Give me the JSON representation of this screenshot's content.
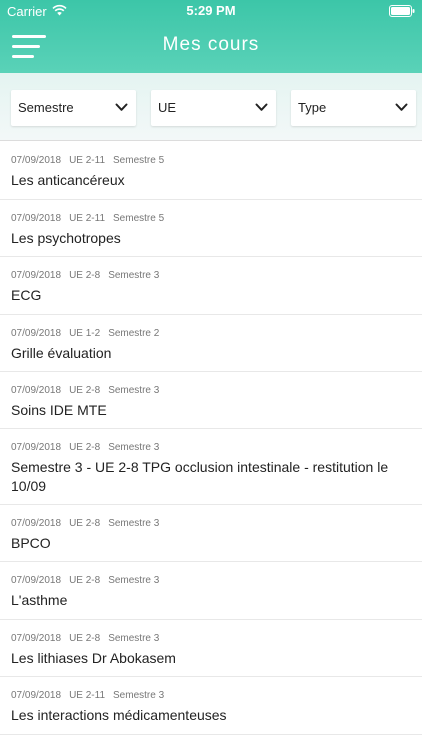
{
  "status": {
    "carrier": "Carrier",
    "time": "5:29 PM"
  },
  "header": {
    "title": "Mes cours"
  },
  "filters": [
    {
      "label": "Semestre"
    },
    {
      "label": "UE"
    },
    {
      "label": "Type"
    }
  ],
  "courses": [
    {
      "date": "07/09/2018",
      "ue": "UE 2-11",
      "semestre": "Semestre 5",
      "title": "Les anticancéreux"
    },
    {
      "date": "07/09/2018",
      "ue": "UE 2-11",
      "semestre": "Semestre 5",
      "title": "Les psychotropes"
    },
    {
      "date": "07/09/2018",
      "ue": "UE 2-8",
      "semestre": "Semestre 3",
      "title": "ECG"
    },
    {
      "date": "07/09/2018",
      "ue": "UE 1-2",
      "semestre": "Semestre 2",
      "title": "Grille évaluation"
    },
    {
      "date": "07/09/2018",
      "ue": "UE 2-8",
      "semestre": "Semestre 3",
      "title": "Soins IDE MTE"
    },
    {
      "date": "07/09/2018",
      "ue": "UE 2-8",
      "semestre": "Semestre 3",
      "title": "Semestre 3 - UE 2-8 TPG occlusion intestinale - restitution le 10/09"
    },
    {
      "date": "07/09/2018",
      "ue": "UE 2-8",
      "semestre": "Semestre 3",
      "title": "BPCO"
    },
    {
      "date": "07/09/2018",
      "ue": "UE 2-8",
      "semestre": "Semestre 3",
      "title": "L'asthme"
    },
    {
      "date": "07/09/2018",
      "ue": "UE 2-8",
      "semestre": "Semestre 3",
      "title": "Les lithiases Dr Abokasem"
    },
    {
      "date": "07/09/2018",
      "ue": "UE 2-11",
      "semestre": "Semestre 3",
      "title": "Les interactions médicamenteuses"
    }
  ]
}
